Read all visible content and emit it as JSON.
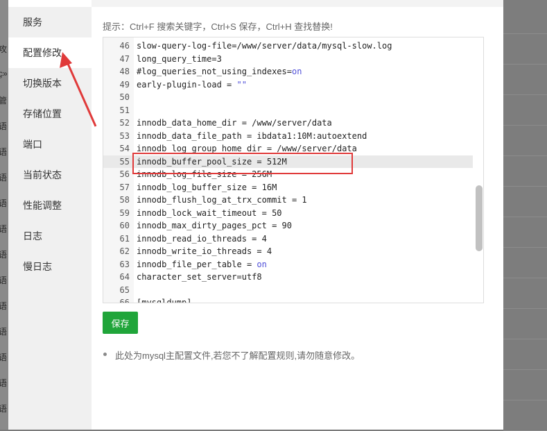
{
  "background_page_chars": [
    "攻",
    "ç»",
    "管",
    "语",
    "语",
    "语",
    "语",
    "语",
    "语",
    "语",
    "语",
    "语",
    "语",
    "语",
    "语"
  ],
  "sidebar": {
    "items": [
      {
        "label": "服务"
      },
      {
        "label": "配置修改"
      },
      {
        "label": "切换版本"
      },
      {
        "label": "存储位置"
      },
      {
        "label": "端口"
      },
      {
        "label": "当前状态"
      },
      {
        "label": "性能调整"
      },
      {
        "label": "日志"
      },
      {
        "label": "慢日志"
      }
    ],
    "active_index": 1
  },
  "tip_text": "提示：Ctrl+F 搜索关键字，Ctrl+S 保存，Ctrl+H 查找替换!",
  "editor": {
    "lines": [
      {
        "n": "46",
        "text": "slow-query-log-file=/www/server/data/mysql-slow.log"
      },
      {
        "n": "47",
        "text": "long_query_time=3"
      },
      {
        "n": "48",
        "text": "#log_queries_not_using_indexes=",
        "kw": "on"
      },
      {
        "n": "49",
        "text": "early-plugin-load = ",
        "kw": "\"\""
      },
      {
        "n": "50",
        "text": ""
      },
      {
        "n": "51",
        "text": ""
      },
      {
        "n": "52",
        "text": "innodb_data_home_dir = /www/server/data"
      },
      {
        "n": "53",
        "text": "innodb_data_file_path = ibdata1:10M:autoextend"
      },
      {
        "n": "54",
        "text": "innodb_log_group_home_dir = /www/server/data"
      },
      {
        "n": "55",
        "text": "innodb_buffer_pool_size = 512M"
      },
      {
        "n": "56",
        "text": "innodb_log_file_size = 256M"
      },
      {
        "n": "57",
        "text": "innodb_log_buffer_size = 16M"
      },
      {
        "n": "58",
        "text": "innodb_flush_log_at_trx_commit = 1"
      },
      {
        "n": "59",
        "text": "innodb_lock_wait_timeout = 50"
      },
      {
        "n": "60",
        "text": "innodb_max_dirty_pages_pct = 90"
      },
      {
        "n": "61",
        "text": "innodb_read_io_threads = 4"
      },
      {
        "n": "62",
        "text": "innodb_write_io_threads = 4"
      },
      {
        "n": "63",
        "text": "innodb_file_per_table = ",
        "kw": "on"
      },
      {
        "n": "64",
        "text": "character_set_server=utf8"
      },
      {
        "n": "65",
        "text": ""
      },
      {
        "n": "66",
        "text": "[mysqldump]"
      }
    ],
    "highlighted_line": "55"
  },
  "save_button": {
    "label": "保存"
  },
  "note_text": "此处为mysql主配置文件,若您不了解配置规则,请勿随意修改。",
  "colors": {
    "save": "#20a53a",
    "annotation": "#e03a3a",
    "keyword": "#4f4fd8"
  }
}
